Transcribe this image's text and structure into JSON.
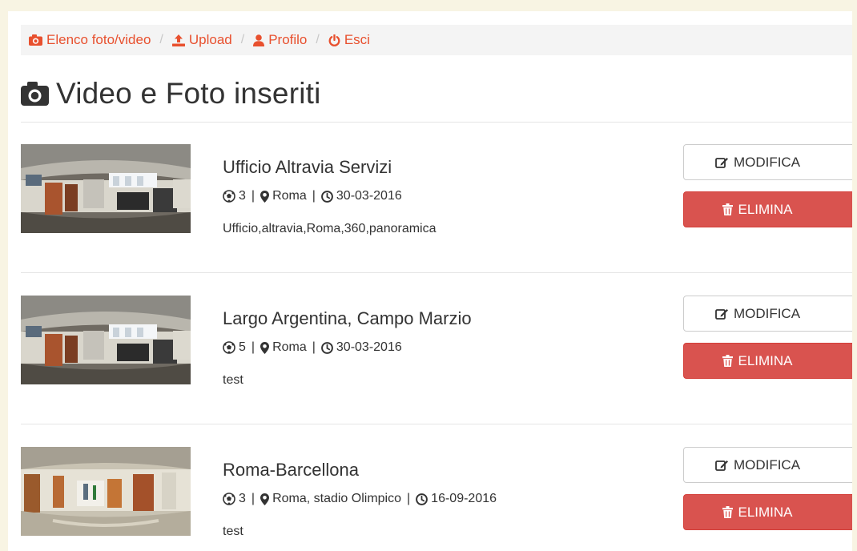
{
  "breadcrumb": [
    {
      "label": "Elenco foto/video",
      "icon": "camera-icon"
    },
    {
      "label": "Upload",
      "icon": "upload-icon"
    },
    {
      "label": "Profilo",
      "icon": "user-icon"
    },
    {
      "label": "Esci",
      "icon": "power-icon"
    }
  ],
  "breadcrumb_separator": "/",
  "page": {
    "title": "Video e Foto inseriti",
    "title_icon": "camera-icon"
  },
  "items": [
    {
      "title": "Ufficio Altravia Servizi",
      "count": "3",
      "location": "Roma",
      "date": "30-03-2016",
      "tags": "Ufficio,altravia,Roma,360,panoramica",
      "thumbnail": "office-panorama"
    },
    {
      "title": "Largo Argentina, Campo Marzio",
      "count": "5",
      "location": "Roma",
      "date": "30-03-2016",
      "tags": "test",
      "thumbnail": "office-panorama"
    },
    {
      "title": "Roma-Barcellona",
      "count": "3",
      "location": "Roma, stadio Olimpico",
      "date": "16-09-2016",
      "tags": "test",
      "thumbnail": "hallway-panorama"
    }
  ],
  "meta_separator": "|",
  "actions": {
    "edit_label": "MODIFICA",
    "delete_label": "ELIMINA"
  },
  "colors": {
    "accent": "#e8502e",
    "danger": "#d9534f",
    "background": "#f8f4e3",
    "breadcrumb_bg": "#f4f4f4"
  }
}
